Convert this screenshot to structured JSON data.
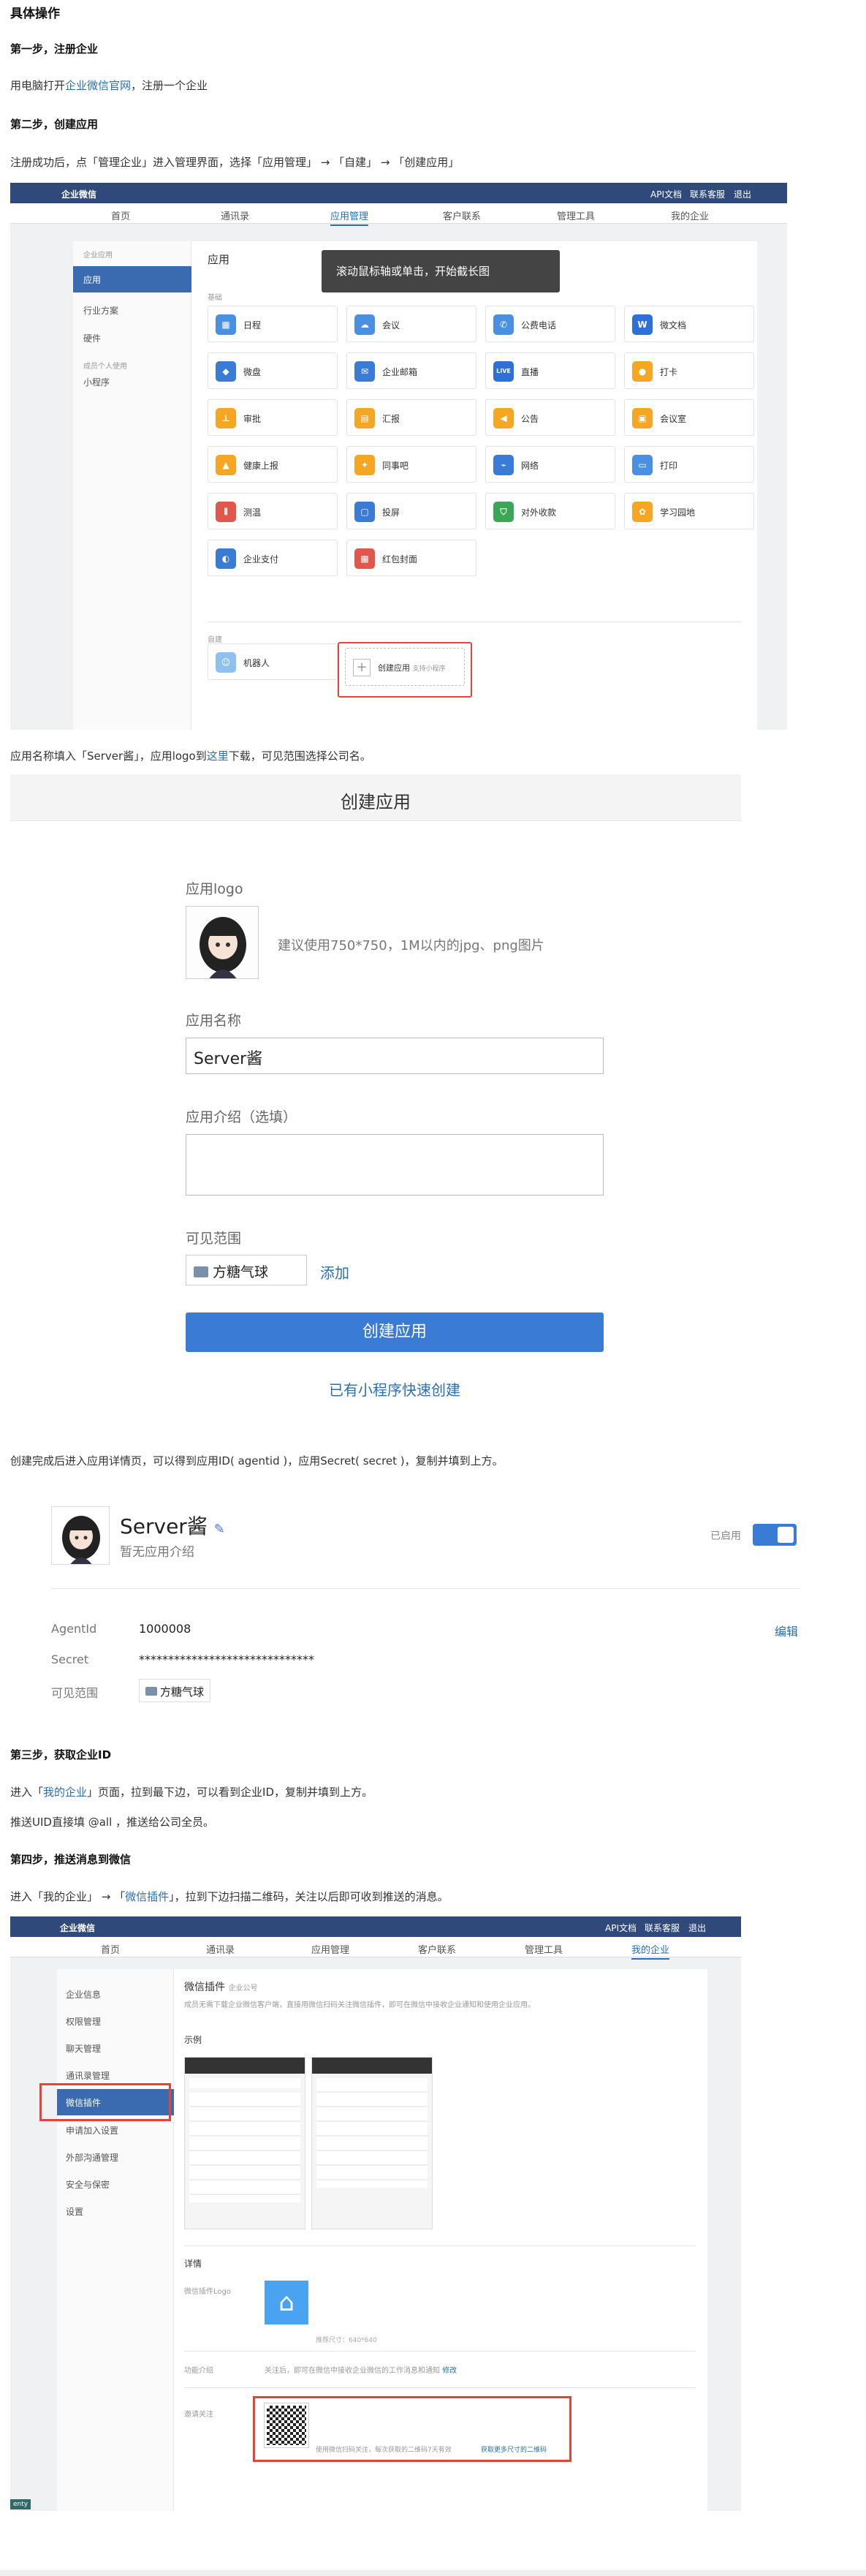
{
  "headings": {
    "main": "具体操作",
    "step1": "第一步，注册企业",
    "step2": "第二步，创建应用",
    "step3": "第三步，获取企业ID",
    "step4": "第四步，推送消息到微信"
  },
  "paragraphs": {
    "p1_a": "用电脑打开",
    "p1_link": "企业微信官网",
    "p1_b": "，注册一个企业",
    "p2": "注册成功后，点「管理企业」进入管理界面，选择「应用管理」 → 「自建」 → 「创建应用」",
    "p3_a": "应用名称填入「Server酱」，应用logo到",
    "p3_link": "这里",
    "p3_b": "下载，可见范围选择公司名。",
    "p4": "创建完成后进入应用详情页，可以得到应用ID( agentid )，应用Secret( secret )，复制并填到上方。",
    "p5_a": "进入「",
    "p5_link": "我的企业",
    "p5_b": "」页面，拉到最下边，可以看到企业ID，复制并填到上方。",
    "p6": "推送UID直接填 @all ，推送给公司全员。",
    "p7_a": "进入「我的企业」 → 「",
    "p7_link": "微信插件",
    "p7_b": "」，拉到下边扫描二维码，关注以后即可收到推送的消息。"
  },
  "shot1": {
    "logo": "企业微信",
    "top_links": [
      "API文档",
      "联系客服",
      "退出"
    ],
    "nav": [
      "首页",
      "通讯录",
      "应用管理",
      "客户联系",
      "管理工具",
      "我的企业"
    ],
    "side_group": "企业应用",
    "side_items": [
      "应用",
      "行业方案",
      "硬件"
    ],
    "side_group2": "成员个人使用",
    "side_item_mini": "小程序",
    "title": "应用",
    "tooltip": "滚动鼠标轴或单击，开始截长图",
    "section_basic": "基础",
    "apps": [
      "日程",
      "会议",
      "公费电话",
      "微文档",
      "微盘",
      "企业邮箱",
      "直播",
      "打卡",
      "审批",
      "汇报",
      "公告",
      "会议室",
      "健康上报",
      "同事吧",
      "网络",
      "打印",
      "测温",
      "投屏",
      "对外收款",
      "学习园地",
      "企业支付",
      "红包封面"
    ],
    "section_self": "自建",
    "robot": "机器人",
    "create_app": "创建应用",
    "create_hint": "支持小程序"
  },
  "shot2": {
    "title": "创建应用",
    "logo_label": "应用logo",
    "logo_hint": "建议使用750*750，1M以内的jpg、png图片",
    "name_label": "应用名称",
    "name_value": "Server酱",
    "intro_label": "应用介绍（选填）",
    "scope_label": "可见范围",
    "scope_value": "方糖气球",
    "add": "添加",
    "submit": "创建应用",
    "mini_link": "已有小程序快速创建"
  },
  "shot3": {
    "app_name": "Server酱",
    "app_desc": "暂无应用介绍",
    "status": "已启用",
    "agentid_label": "AgentId",
    "agentid_value": "1000008",
    "secret_label": "Secret",
    "secret_value": "******************************",
    "scope_label": "可见范围",
    "scope_value": "方糖气球",
    "edit": "编辑"
  },
  "shot4": {
    "logo": "企业微信",
    "top_links": [
      "API文档",
      "联系客服",
      "退出"
    ],
    "nav": [
      "首页",
      "通讯录",
      "应用管理",
      "客户联系",
      "管理工具",
      "我的企业"
    ],
    "side_items": [
      "企业信息",
      "权限管理",
      "聊天管理",
      "通讯录管理",
      "微信插件",
      "申请加入设置",
      "外部沟通管理",
      "安全与保密",
      "设置"
    ],
    "title": "微信插件",
    "title_tag": "企业公号",
    "desc": "成员无需下载企业微信客户端，直接用微信扫码关注微信插件，即可在微信中接收企业通知和使用企业应用。",
    "example": "示例",
    "detail": "详情",
    "logo_label": "微信插件Logo",
    "logo_hint": "推荐尺寸：640*640",
    "func_label": "功能介绍",
    "func_text": "关注后，即可在微信中接收企业微信的工作消息和通知",
    "func_edit": "修改",
    "follow_label": "邀请关注",
    "qr_hint": "使用微信扫码关注，每次获取的二维码7天有效",
    "qr_more": "获取更多尺寸的二维码",
    "corner_tag": "enty"
  },
  "colors": {
    "link": "#2a6fb0",
    "topbar": "#2f4a7a",
    "primary": "#3a7bd5",
    "highlight_red": "#e0443a"
  }
}
